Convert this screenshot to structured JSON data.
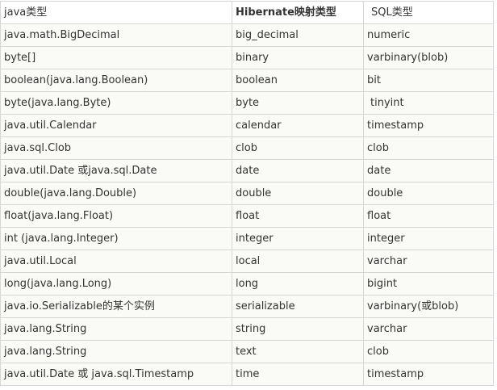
{
  "table": {
    "headers": [
      "java类型",
      "Hibernate映射类型",
      "SQL类型"
    ],
    "rows": [
      [
        "java.math.BigDecimal",
        "big_decimal",
        "numeric"
      ],
      [
        "byte[]",
        "binary",
        "varbinary(blob)"
      ],
      [
        "boolean(java.lang.Boolean)",
        "boolean",
        "bit"
      ],
      [
        "byte(java.lang.Byte)",
        "byte",
        "tinyint"
      ],
      [
        "java.util.Calendar",
        "calendar",
        "timestamp"
      ],
      [
        "java.sql.Clob",
        "clob",
        "clob"
      ],
      [
        "java.util.Date 或java.sql.Date",
        "date",
        "date"
      ],
      [
        "double(java.lang.Double)",
        "double",
        "double"
      ],
      [
        "float(java.lang.Float)",
        "float",
        "float"
      ],
      [
        "int (java.lang.Integer)",
        "integer",
        "integer"
      ],
      [
        "java.util.Local",
        "local",
        "varchar"
      ],
      [
        "long(java.lang.Long)",
        "long",
        "bigint"
      ],
      [
        "java.io.Serializable的某个实例",
        "serializable",
        "varbinary(或blob)"
      ],
      [
        "java.lang.String",
        "string",
        "varchar"
      ],
      [
        "java.lang.String",
        "text",
        "clob"
      ],
      [
        "java.util.Date 或 java.sql.Timestamp",
        "time",
        "timestamp"
      ]
    ]
  }
}
